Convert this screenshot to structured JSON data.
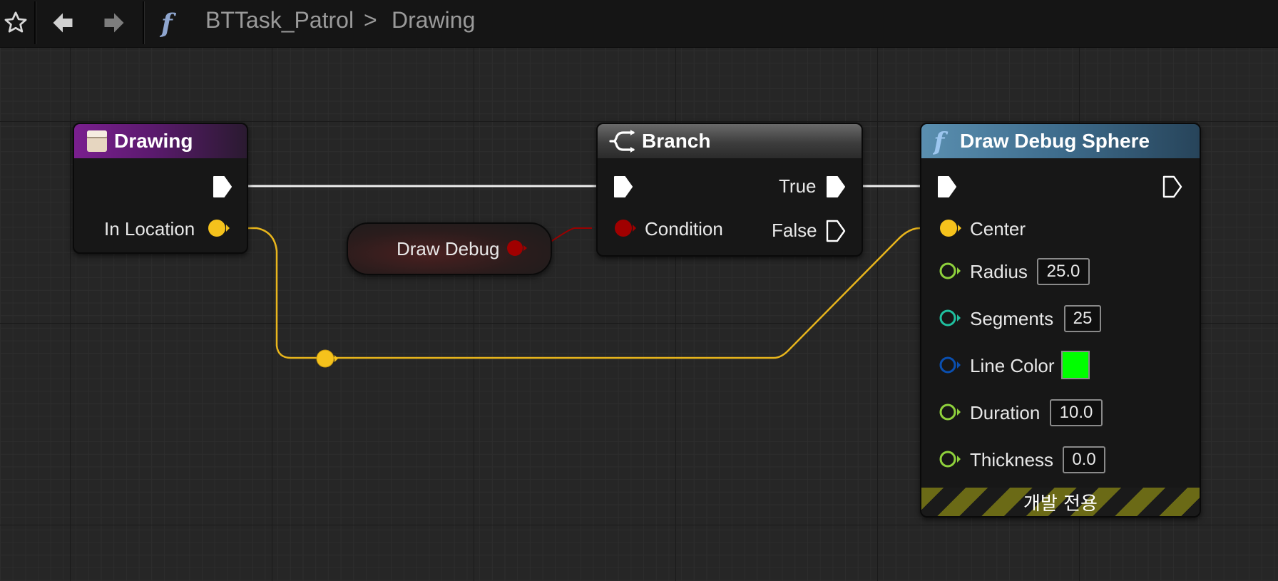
{
  "breadcrumb": {
    "graph": "BTTask_Patrol",
    "separator": ">",
    "function": "Drawing"
  },
  "nodes": {
    "drawing": {
      "title": "Drawing",
      "pin_in_location": "In Location"
    },
    "draw_debug_var": {
      "label": "Draw Debug"
    },
    "branch": {
      "title": "Branch",
      "pin_condition": "Condition",
      "pin_true": "True",
      "pin_false": "False"
    },
    "sphere": {
      "title": "Draw Debug Sphere",
      "pin_center": "Center",
      "pin_radius": "Radius",
      "radius_value": "25.0",
      "pin_segments": "Segments",
      "segments_value": "25",
      "pin_line_color": "Line Color",
      "line_color": "#00ff00",
      "pin_duration": "Duration",
      "duration_value": "10.0",
      "pin_thickness": "Thickness",
      "thickness_value": "0.0",
      "dev_only": "개발 전용"
    }
  },
  "colors": {
    "exec": "#ffffff",
    "vector": "#f5c21c",
    "boolean": "#a00000",
    "float": "#8fd13c",
    "int": "#20c0a0",
    "struct": "#0a4fb0"
  },
  "icons": [
    "star-icon",
    "back-arrow-icon",
    "forward-arrow-icon",
    "function-icon",
    "event-icon",
    "branch-icon"
  ]
}
